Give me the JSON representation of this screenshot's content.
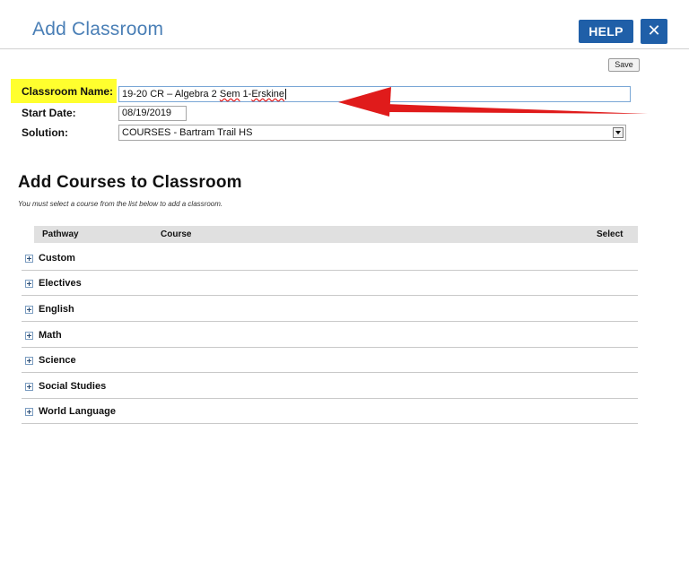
{
  "header": {
    "title": "Add Classroom",
    "help_label": "HELP",
    "close_label": "✕"
  },
  "toolbar": {
    "save_label": "Save"
  },
  "form": {
    "classroom_name_label": "Classroom Name:",
    "classroom_name_value_prefix": "19-20 CR – Algebra 2 ",
    "classroom_name_value_sem": "Sem",
    "classroom_name_value_mid": " 1-",
    "classroom_name_value_surname": "Erskine",
    "start_date_label": "Start Date:",
    "start_date_value": "08/19/2019",
    "solution_label": "Solution:",
    "solution_value": "COURSES - Bartram Trail HS"
  },
  "courses": {
    "title": "Add Courses to Classroom",
    "helper": "You must select a course from the list below to add a classroom.",
    "columns": {
      "pathway": "Pathway",
      "course": "Course",
      "select": "Select"
    },
    "pathways": [
      "Custom",
      "Electives",
      "English",
      "Math",
      "Science",
      "Social Studies",
      "World Language"
    ]
  },
  "colors": {
    "accent": "#1f5fa8",
    "title": "#4a7fb6",
    "highlight": "#ffff2e",
    "annotation_arrow": "#e01b1b"
  },
  "icons": {
    "close": "close-icon",
    "expand": "plus-box-icon",
    "dropdown": "chevron-down-icon"
  }
}
